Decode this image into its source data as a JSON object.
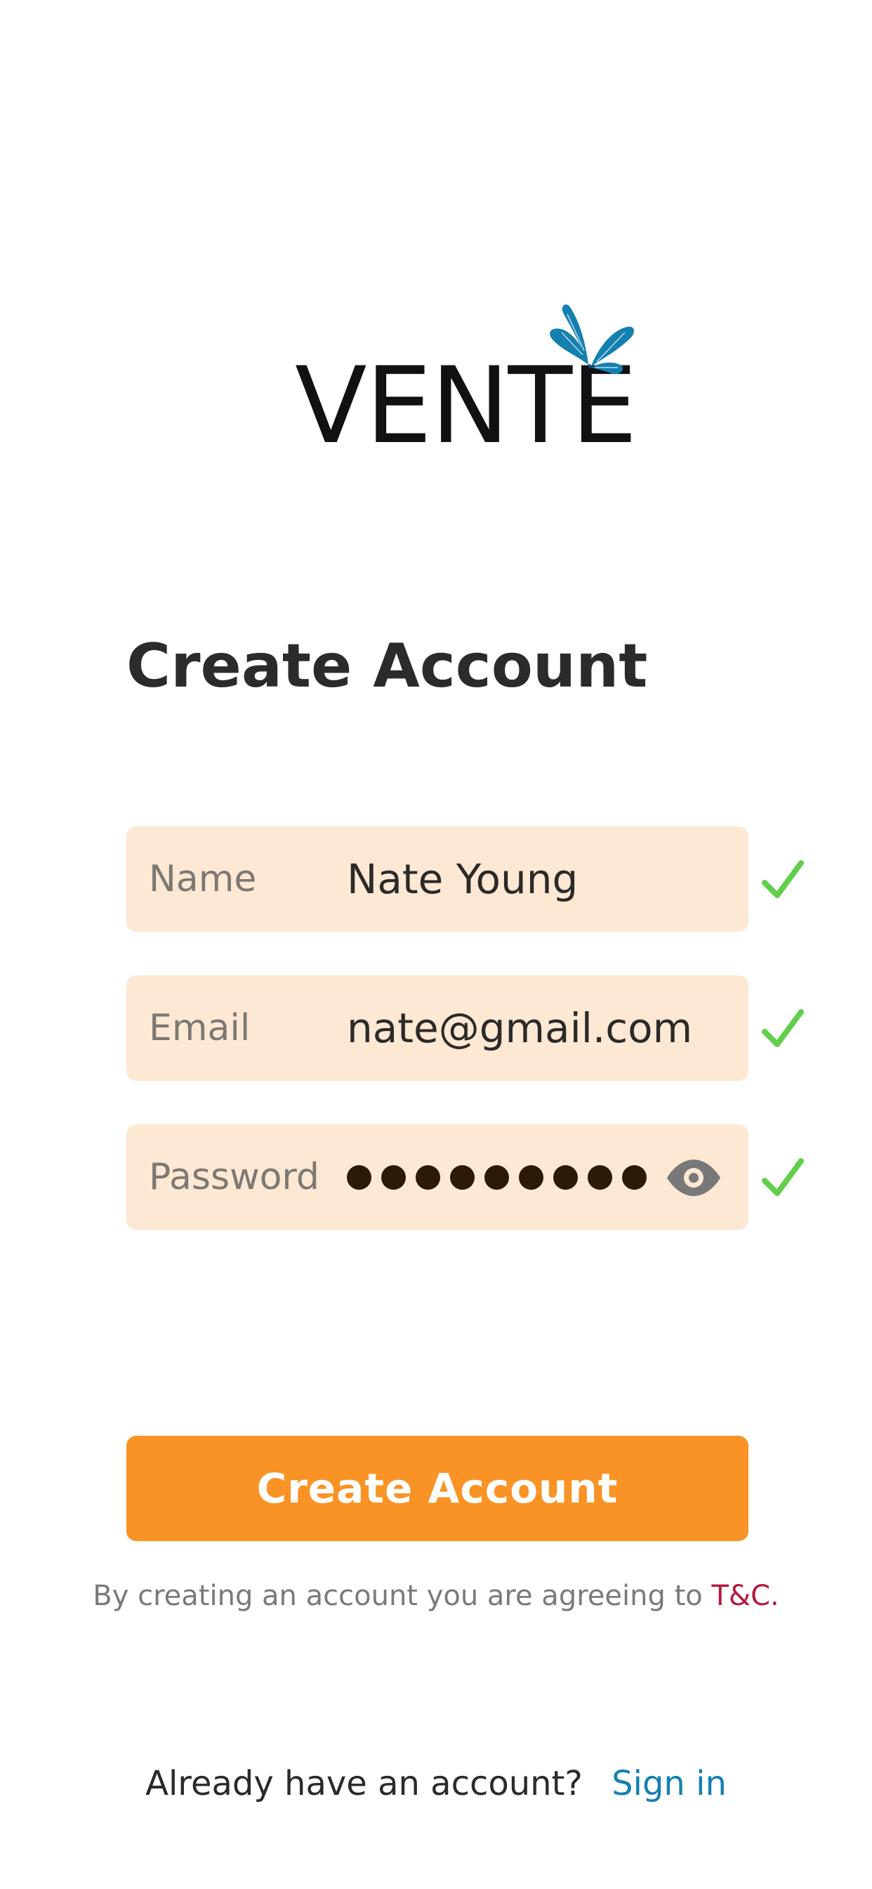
{
  "app": {
    "logo_text": "VENTE",
    "brand_color": "#1480b0",
    "accent_color": "#fa9325"
  },
  "form": {
    "title": "Create Account",
    "fields": [
      {
        "label": "Name",
        "value": "Nate Young",
        "valid": true
      },
      {
        "label": "Email",
        "value": "nate@gmail.com",
        "valid": true
      },
      {
        "label": "Password",
        "masked_length": 9,
        "valid": true,
        "toggle_icon": "eye-icon"
      }
    ],
    "submit_label": "Create Account",
    "terms_text": "By creating an account you are agreeing to",
    "terms_link": "T&C."
  },
  "footer": {
    "prompt": "Already have an account?",
    "signin_link": "Sign in"
  },
  "colors": {
    "field_bg": "#fde8d3",
    "check": "#62cf4a",
    "terms_link": "#b41a3c"
  }
}
